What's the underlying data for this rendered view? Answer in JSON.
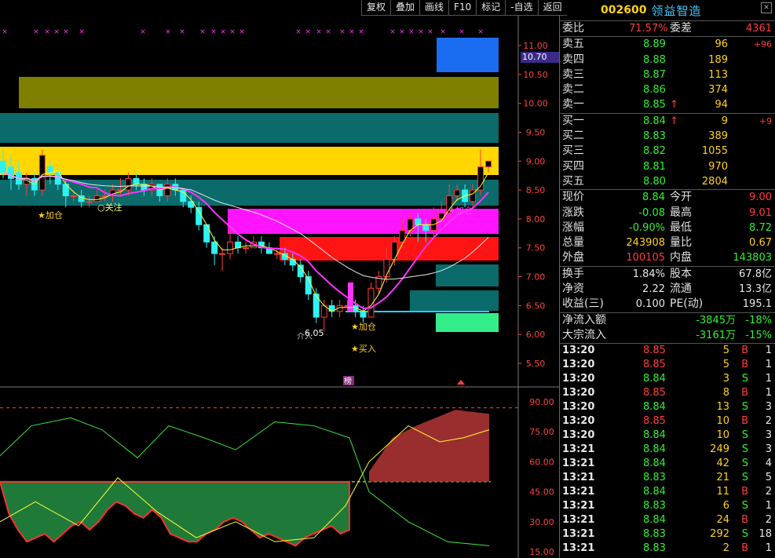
{
  "toolbar": {
    "fuquan": "复权",
    "diejia": "叠加",
    "huaxian": "画线",
    "f10": "F10",
    "biaoji": "标记",
    "zixuan": "-自选",
    "fanhui": "返回"
  },
  "price_tag": "10.70",
  "axis": {
    "price_labels": [
      "11.00",
      "10.50",
      "10.00",
      "9.50",
      "9.00",
      "8.50",
      "8.00",
      "7.50",
      "7.00",
      "6.50",
      "6.00",
      "5.50"
    ],
    "osc_labels": [
      "90.00",
      "75.00",
      "60.00",
      "45.00",
      "30.00",
      "15.00"
    ]
  },
  "annotations": {
    "jiacang1": "★加仓",
    "jiacang2": "★加仓",
    "guanzhu": "○关注",
    "low_price": "6.05",
    "shijie": "介入",
    "mairu": "★买入",
    "bang": "榜"
  },
  "stock": {
    "code": "002600",
    "name": "领益智造"
  },
  "weibi": {
    "label": "委比",
    "value": "71.57%",
    "label2": "委差",
    "value2": "4361"
  },
  "sell": [
    {
      "label": "卖五",
      "price": "8.89",
      "vol": "96",
      "chg": "+96",
      "arrow": ""
    },
    {
      "label": "卖四",
      "price": "8.88",
      "vol": "189",
      "chg": "",
      "arrow": ""
    },
    {
      "label": "卖三",
      "price": "8.87",
      "vol": "113",
      "chg": "",
      "arrow": ""
    },
    {
      "label": "卖二",
      "price": "8.86",
      "vol": "374",
      "chg": "",
      "arrow": ""
    },
    {
      "label": "卖一",
      "price": "8.85",
      "vol": "94",
      "chg": "",
      "arrow": "↑"
    }
  ],
  "buy": [
    {
      "label": "买一",
      "price": "8.84",
      "vol": "9",
      "chg": "+9",
      "arrow": "↑"
    },
    {
      "label": "买二",
      "price": "8.83",
      "vol": "389",
      "chg": "",
      "arrow": ""
    },
    {
      "label": "买三",
      "price": "8.82",
      "vol": "1055",
      "chg": "",
      "arrow": ""
    },
    {
      "label": "买四",
      "price": "8.81",
      "vol": "970",
      "chg": "",
      "arrow": ""
    },
    {
      "label": "买五",
      "price": "8.80",
      "vol": "2804",
      "chg": "",
      "arrow": ""
    }
  ],
  "quote": [
    {
      "l1": "现价",
      "v1": "8.84",
      "c1": "green",
      "l2": "今开",
      "v2": "9.00",
      "c2": "red"
    },
    {
      "l1": "涨跌",
      "v1": "-0.08",
      "c1": "green",
      "l2": "最高",
      "v2": "9.01",
      "c2": "red"
    },
    {
      "l1": "涨幅",
      "v1": "-0.90%",
      "c1": "green",
      "l2": "最低",
      "v2": "8.72",
      "c2": "green"
    },
    {
      "l1": "总量",
      "v1": "243908",
      "c1": "yel",
      "l2": "量比",
      "v2": "0.67",
      "c2": "yel"
    },
    {
      "l1": "外盘",
      "v1": "100105",
      "c1": "red",
      "l2": "内盘",
      "v2": "143803",
      "c2": "green"
    }
  ],
  "fund": [
    {
      "l1": "换手",
      "v1": "1.84%",
      "c1": "wht",
      "l2": "股本",
      "v2": "67.8亿",
      "c2": "wht"
    },
    {
      "l1": "净资",
      "v1": "2.22",
      "c1": "wht",
      "l2": "流通",
      "v2": "13.3亿",
      "c2": "wht"
    },
    {
      "l1": "收益(三)",
      "v1": "0.100",
      "c1": "wht",
      "l2": "PE(动)",
      "v2": "195.1",
      "c2": "wht"
    }
  ],
  "flow": [
    {
      "label": "净流入额",
      "value": "-3845万",
      "pct": "-18%"
    },
    {
      "label": "大宗流入",
      "value": "-3161万",
      "pct": "-15%"
    }
  ],
  "ticks": [
    {
      "time": "13:20",
      "price": "8.85",
      "pc": "red",
      "vol": "5",
      "bs": "B",
      "n": "1"
    },
    {
      "time": "13:20",
      "price": "8.85",
      "pc": "red",
      "vol": "5",
      "bs": "B",
      "n": "1"
    },
    {
      "time": "13:20",
      "price": "8.84",
      "pc": "green",
      "vol": "3",
      "bs": "S",
      "n": "1"
    },
    {
      "time": "13:20",
      "price": "8.85",
      "pc": "red",
      "vol": "8",
      "bs": "B",
      "n": "1"
    },
    {
      "time": "13:20",
      "price": "8.84",
      "pc": "green",
      "vol": "13",
      "bs": "S",
      "n": "3"
    },
    {
      "time": "13:20",
      "price": "8.85",
      "pc": "red",
      "vol": "10",
      "bs": "B",
      "n": "2"
    },
    {
      "time": "13:20",
      "price": "8.84",
      "pc": "green",
      "vol": "10",
      "bs": "S",
      "n": "3"
    },
    {
      "time": "13:21",
      "price": "8.84",
      "pc": "green",
      "vol": "249",
      "bs": "S",
      "n": "3"
    },
    {
      "time": "13:21",
      "price": "8.84",
      "pc": "green",
      "vol": "42",
      "bs": "S",
      "n": "4"
    },
    {
      "time": "13:21",
      "price": "8.83",
      "pc": "green",
      "vol": "21",
      "bs": "S",
      "n": "5"
    },
    {
      "time": "13:21",
      "price": "8.84",
      "pc": "green",
      "vol": "11",
      "bs": "B",
      "n": "2"
    },
    {
      "time": "13:21",
      "price": "8.83",
      "pc": "green",
      "vol": "6",
      "bs": "S",
      "n": "1"
    },
    {
      "time": "13:21",
      "price": "8.84",
      "pc": "green",
      "vol": "24",
      "bs": "B",
      "n": "2"
    },
    {
      "time": "13:21",
      "price": "8.83",
      "pc": "green",
      "vol": "292",
      "bs": "S",
      "n": "18"
    },
    {
      "time": "13:21",
      "price": "8.83",
      "pc": "green",
      "vol": "2",
      "bs": "B",
      "n": "1"
    }
  ],
  "colors": {
    "up": "#ff3c3c",
    "down": "#2ef2f2",
    "ma_fast": "#ffff33",
    "ma_mid": "#ff33ff",
    "ma_slow": "#e8e8e8"
  }
}
